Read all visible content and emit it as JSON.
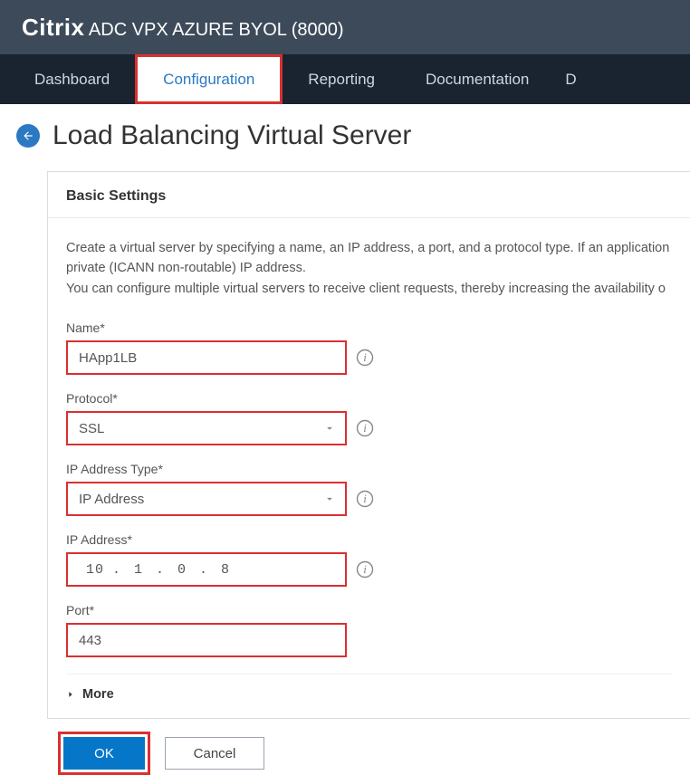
{
  "brand": {
    "name": "Citrix",
    "product": "ADC VPX AZURE BYOL (8000)"
  },
  "nav": {
    "items": [
      "Dashboard",
      "Configuration",
      "Reporting",
      "Documentation"
    ],
    "truncated": "D",
    "active_index": 1
  },
  "page_title": "Load Balancing Virtual Server",
  "panel": {
    "title": "Basic Settings",
    "desc_line1": "Create a virtual server by specifying a name, an IP address, a port, and a protocol type. If an application",
    "desc_line2": "private (ICANN non-routable) IP address.",
    "desc_line3": "You can configure multiple virtual servers to receive client requests, thereby increasing the availability o"
  },
  "fields": {
    "name": {
      "label": "Name*",
      "value": "HApp1LB"
    },
    "protocol": {
      "label": "Protocol*",
      "value": "SSL"
    },
    "ip_type": {
      "label": "IP Address Type*",
      "value": "IP Address"
    },
    "ip_addr": {
      "label": "IP Address*",
      "octets": [
        "10",
        "1",
        "0",
        "8"
      ]
    },
    "port": {
      "label": "Port*",
      "value": "443"
    }
  },
  "more_label": "More",
  "buttons": {
    "ok": "OK",
    "cancel": "Cancel"
  }
}
